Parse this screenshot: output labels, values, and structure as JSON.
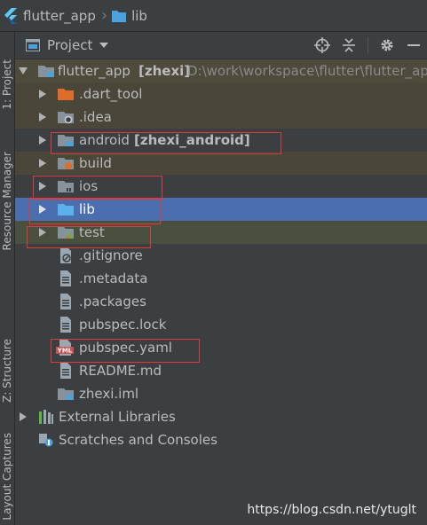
{
  "breadcrumb": {
    "project": "flutter_app",
    "folder": "lib"
  },
  "side_tabs": [
    "1: Project",
    "Resource Manager",
    "Z: Structure",
    "Layout Captures"
  ],
  "panel": {
    "title": "Project"
  },
  "tree": {
    "root": {
      "name": "flutter_app",
      "module": "[zhexi]",
      "path": "D:\\work\\workspace\\flutter\\flutter_app"
    },
    "items": [
      {
        "label": "flutter_app",
        "icon": "folder-module-icon"
      },
      {
        "label": ".dart_tool",
        "icon": "folder-orange-icon"
      },
      {
        "label": ".idea",
        "icon": "folder-settings-icon"
      },
      {
        "label": "android",
        "extra": "[zhexi_android]",
        "icon": "folder-module-icon"
      },
      {
        "label": "build",
        "icon": "folder-excluded-icon"
      },
      {
        "label": "ios",
        "icon": "folder-icon"
      },
      {
        "label": "lib",
        "icon": "folder-source-icon"
      },
      {
        "label": "test",
        "icon": "folder-test-icon"
      },
      {
        "label": ".gitignore",
        "icon": "ignore-file-icon"
      },
      {
        "label": ".metadata",
        "icon": "file-icon"
      },
      {
        "label": ".packages",
        "icon": "file-icon"
      },
      {
        "label": "pubspec.lock",
        "icon": "file-icon"
      },
      {
        "label": "pubspec.yaml",
        "icon": "yaml-file-icon"
      },
      {
        "label": "README.md",
        "icon": "file-icon"
      },
      {
        "label": "zhexi.iml",
        "icon": "iml-file-icon"
      },
      {
        "label": "External Libraries",
        "icon": "libraries-icon"
      },
      {
        "label": "Scratches and Consoles",
        "icon": "scratches-icon"
      }
    ]
  },
  "watermark": "https://blog.csdn.net/ytuglt",
  "colors": {
    "selection": "#4b6eaf",
    "highlight_box": "#e0383b",
    "background": "#3c3f41"
  }
}
